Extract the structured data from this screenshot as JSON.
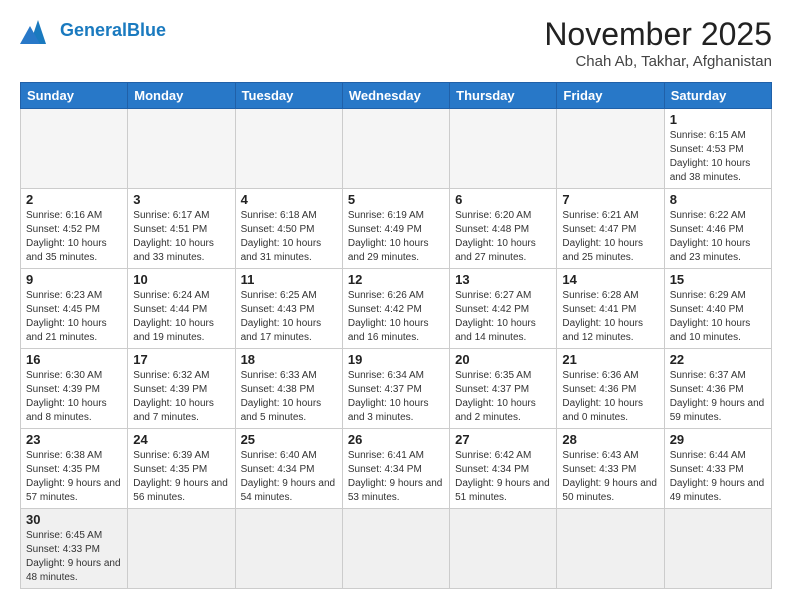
{
  "header": {
    "logo_general": "General",
    "logo_blue": "Blue",
    "month": "November 2025",
    "location": "Chah Ab, Takhar, Afghanistan"
  },
  "weekdays": [
    "Sunday",
    "Monday",
    "Tuesday",
    "Wednesday",
    "Thursday",
    "Friday",
    "Saturday"
  ],
  "days": {
    "d1": {
      "n": "1",
      "sr": "6:15 AM",
      "ss": "4:53 PM",
      "dl": "10 hours and 38 minutes."
    },
    "d2": {
      "n": "2",
      "sr": "6:16 AM",
      "ss": "4:52 PM",
      "dl": "10 hours and 35 minutes."
    },
    "d3": {
      "n": "3",
      "sr": "6:17 AM",
      "ss": "4:51 PM",
      "dl": "10 hours and 33 minutes."
    },
    "d4": {
      "n": "4",
      "sr": "6:18 AM",
      "ss": "4:50 PM",
      "dl": "10 hours and 31 minutes."
    },
    "d5": {
      "n": "5",
      "sr": "6:19 AM",
      "ss": "4:49 PM",
      "dl": "10 hours and 29 minutes."
    },
    "d6": {
      "n": "6",
      "sr": "6:20 AM",
      "ss": "4:48 PM",
      "dl": "10 hours and 27 minutes."
    },
    "d7": {
      "n": "7",
      "sr": "6:21 AM",
      "ss": "4:47 PM",
      "dl": "10 hours and 25 minutes."
    },
    "d8": {
      "n": "8",
      "sr": "6:22 AM",
      "ss": "4:46 PM",
      "dl": "10 hours and 23 minutes."
    },
    "d9": {
      "n": "9",
      "sr": "6:23 AM",
      "ss": "4:45 PM",
      "dl": "10 hours and 21 minutes."
    },
    "d10": {
      "n": "10",
      "sr": "6:24 AM",
      "ss": "4:44 PM",
      "dl": "10 hours and 19 minutes."
    },
    "d11": {
      "n": "11",
      "sr": "6:25 AM",
      "ss": "4:43 PM",
      "dl": "10 hours and 17 minutes."
    },
    "d12": {
      "n": "12",
      "sr": "6:26 AM",
      "ss": "4:42 PM",
      "dl": "10 hours and 16 minutes."
    },
    "d13": {
      "n": "13",
      "sr": "6:27 AM",
      "ss": "4:42 PM",
      "dl": "10 hours and 14 minutes."
    },
    "d14": {
      "n": "14",
      "sr": "6:28 AM",
      "ss": "4:41 PM",
      "dl": "10 hours and 12 minutes."
    },
    "d15": {
      "n": "15",
      "sr": "6:29 AM",
      "ss": "4:40 PM",
      "dl": "10 hours and 10 minutes."
    },
    "d16": {
      "n": "16",
      "sr": "6:30 AM",
      "ss": "4:39 PM",
      "dl": "10 hours and 8 minutes."
    },
    "d17": {
      "n": "17",
      "sr": "6:32 AM",
      "ss": "4:39 PM",
      "dl": "10 hours and 7 minutes."
    },
    "d18": {
      "n": "18",
      "sr": "6:33 AM",
      "ss": "4:38 PM",
      "dl": "10 hours and 5 minutes."
    },
    "d19": {
      "n": "19",
      "sr": "6:34 AM",
      "ss": "4:37 PM",
      "dl": "10 hours and 3 minutes."
    },
    "d20": {
      "n": "20",
      "sr": "6:35 AM",
      "ss": "4:37 PM",
      "dl": "10 hours and 2 minutes."
    },
    "d21": {
      "n": "21",
      "sr": "6:36 AM",
      "ss": "4:36 PM",
      "dl": "10 hours and 0 minutes."
    },
    "d22": {
      "n": "22",
      "sr": "6:37 AM",
      "ss": "4:36 PM",
      "dl": "9 hours and 59 minutes."
    },
    "d23": {
      "n": "23",
      "sr": "6:38 AM",
      "ss": "4:35 PM",
      "dl": "9 hours and 57 minutes."
    },
    "d24": {
      "n": "24",
      "sr": "6:39 AM",
      "ss": "4:35 PM",
      "dl": "9 hours and 56 minutes."
    },
    "d25": {
      "n": "25",
      "sr": "6:40 AM",
      "ss": "4:34 PM",
      "dl": "9 hours and 54 minutes."
    },
    "d26": {
      "n": "26",
      "sr": "6:41 AM",
      "ss": "4:34 PM",
      "dl": "9 hours and 53 minutes."
    },
    "d27": {
      "n": "27",
      "sr": "6:42 AM",
      "ss": "4:34 PM",
      "dl": "9 hours and 51 minutes."
    },
    "d28": {
      "n": "28",
      "sr": "6:43 AM",
      "ss": "4:33 PM",
      "dl": "9 hours and 50 minutes."
    },
    "d29": {
      "n": "29",
      "sr": "6:44 AM",
      "ss": "4:33 PM",
      "dl": "9 hours and 49 minutes."
    },
    "d30": {
      "n": "30",
      "sr": "6:45 AM",
      "ss": "4:33 PM",
      "dl": "9 hours and 48 minutes."
    }
  },
  "labels": {
    "sunrise": "Sunrise:",
    "sunset": "Sunset:",
    "daylight": "Daylight:"
  }
}
